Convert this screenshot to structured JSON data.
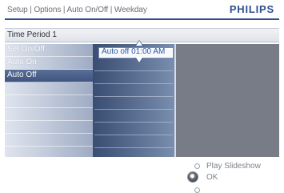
{
  "header": {
    "breadcrumb": "Setup | Options | Auto On/Off | Weekday",
    "brand": "PHILIPS"
  },
  "title_strip": {
    "label": "Time Period 1"
  },
  "menu": {
    "items": [
      {
        "label": "Set On/Off"
      },
      {
        "label": "Auto On"
      },
      {
        "label": "Auto Off"
      }
    ],
    "selected": "Auto Off"
  },
  "value_selector": {
    "value": "Auto  off  01:00 AM"
  },
  "footer": {
    "play_label": "Play Slideshow",
    "ok_label": "OK"
  },
  "colors": {
    "brand": "#2e4f8f",
    "selected_row": "#4a5f8a",
    "value_text": "#2b5aa6"
  }
}
